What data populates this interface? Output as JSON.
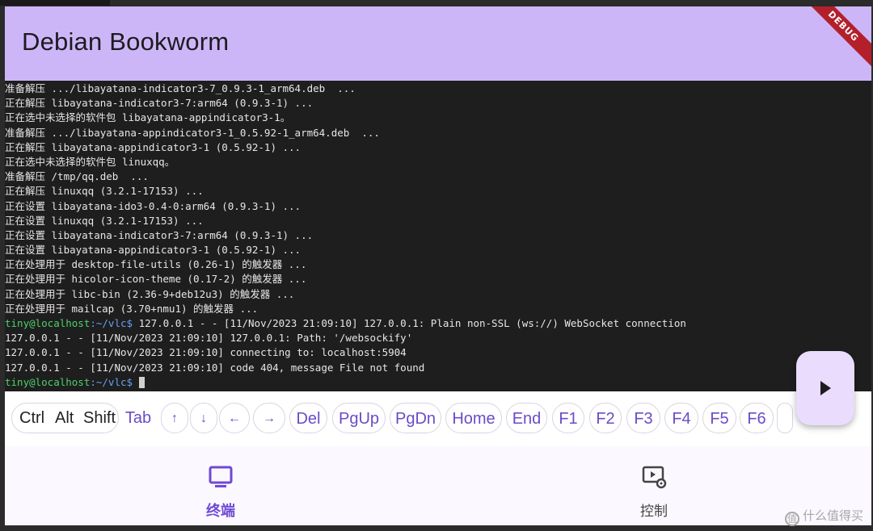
{
  "appbar": {
    "title": "Debian Bookworm",
    "debug_banner": "DEBUG"
  },
  "terminal": {
    "lines": [
      "准备解压 .../libayatana-indicator3-7_0.9.3-1_arm64.deb  ...",
      "正在解压 libayatana-indicator3-7:arm64 (0.9.3-1) ...",
      "正在选中未选择的软件包 libayatana-appindicator3-1。",
      "准备解压 .../libayatana-appindicator3-1_0.5.92-1_arm64.deb  ...",
      "正在解压 libayatana-appindicator3-1 (0.5.92-1) ...",
      "正在选中未选择的软件包 linuxqq。",
      "准备解压 /tmp/qq.deb  ...",
      "正在解压 linuxqq (3.2.1-17153) ...",
      "正在设置 libayatana-ido3-0.4-0:arm64 (0.9.3-1) ...",
      "正在设置 linuxqq (3.2.1-17153) ...",
      "正在设置 libayatana-indicator3-7:arm64 (0.9.3-1) ...",
      "正在设置 libayatana-appindicator3-1 (0.5.92-1) ...",
      "正在处理用于 desktop-file-utils (0.26-1) 的触发器 ...",
      "正在处理用于 hicolor-icon-theme (0.17-2) 的触发器 ...",
      "正在处理用于 libc-bin (2.36-9+deb12u3) 的触发器 ...",
      "正在处理用于 mailcap (3.70+nmu1) 的触发器 ..."
    ],
    "prompt_user": "tiny@localhost",
    "prompt_path": ":~/vlc$",
    "prompt_line_1_rest": " 127.0.0.1 - - [11/Nov/2023 21:09:10] 127.0.0.1: Plain non-SSL (ws://) WebSocket connection",
    "log_lines": [
      "127.0.0.1 - - [11/Nov/2023 21:09:10] 127.0.0.1: Path: '/websockify'",
      "127.0.0.1 - - [11/Nov/2023 21:09:10] connecting to: localhost:5904",
      "127.0.0.1 - - [11/Nov/2023 21:09:10] code 404, message File not found"
    ]
  },
  "keybar": {
    "modifiers": [
      "Ctrl",
      "Alt",
      "Shift"
    ],
    "keys": [
      "Tab",
      "↑",
      "↓",
      "←",
      "→",
      "Del",
      "PgUp",
      "PgDn",
      "Home",
      "End",
      "F1",
      "F2",
      "F3",
      "F4",
      "F5",
      "F6"
    ]
  },
  "fab": {
    "icon": "play-arrow-icon"
  },
  "navbar": {
    "items": [
      {
        "label": "终端",
        "icon": "monitor-icon",
        "active": true
      },
      {
        "label": "控制",
        "icon": "video-settings-icon",
        "active": false
      }
    ]
  },
  "watermark": {
    "text": "什么值得买",
    "logo": "值"
  },
  "colors": {
    "appbar": "#cdb6f8",
    "accent": "#6e4ad4",
    "terminal_bg": "#1e1e1e",
    "prompt_user": "#4ed16a"
  }
}
